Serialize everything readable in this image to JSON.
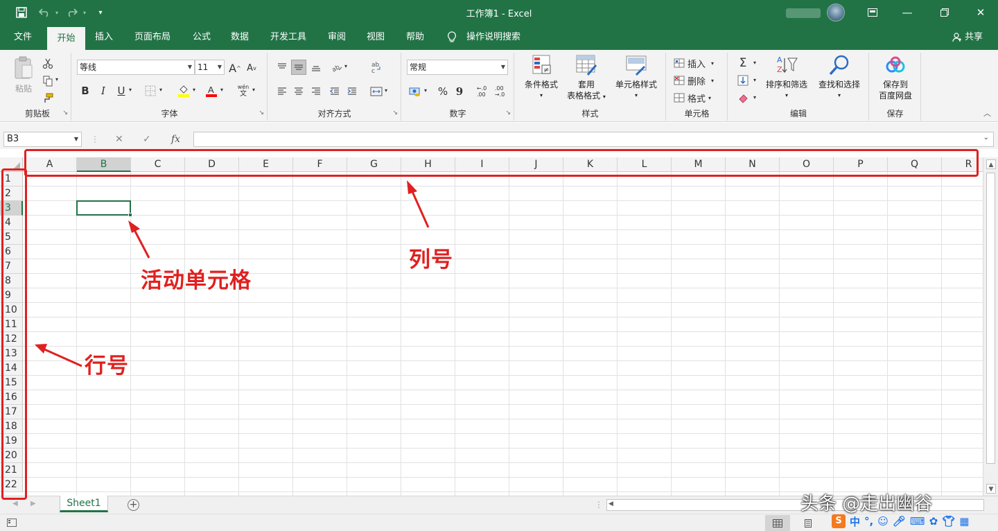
{
  "titlebar": {
    "title": "工作簿1  -  Excel",
    "save_icon": "save-icon",
    "undo_icon": "undo-icon",
    "redo_icon": "redo-icon"
  },
  "tabs": [
    "文件",
    "开始",
    "插入",
    "页面布局",
    "公式",
    "数据",
    "开发工具",
    "审阅",
    "视图",
    "帮助"
  ],
  "tell_me": "操作说明搜索",
  "share": "共享",
  "ribbon": {
    "clipboard": {
      "paste": "粘贴",
      "label": "剪贴板"
    },
    "font": {
      "name": "等线",
      "size": "11",
      "grow": "A",
      "shrink": "A",
      "bold": "B",
      "italic": "I",
      "underline": "U",
      "wen": "wén",
      "label": "字体"
    },
    "alignment": {
      "label": "对齐方式"
    },
    "number": {
      "format": "常规",
      "percent": "%",
      "comma": "9",
      "inc_dec": "←.0\n.00",
      "dec_dec": ".00\n→.0",
      "label": "数字"
    },
    "styles": {
      "conditional": "条件格式",
      "table_1": "套用",
      "table_2": "表格格式",
      "cell_styles": "单元格样式",
      "label": "样式"
    },
    "cells": {
      "insert": "插入",
      "delete": "删除",
      "format": "格式",
      "label": "单元格"
    },
    "editing": {
      "sort": "排序和筛选",
      "find": "查找和选择",
      "label": "编辑",
      "sigma": "Σ"
    },
    "save": {
      "line1": "保存到",
      "line2": "百度网盘",
      "label": "保存"
    }
  },
  "formula_bar": {
    "name_box": "B3",
    "fx": "fx"
  },
  "grid": {
    "columns": [
      "A",
      "B",
      "C",
      "D",
      "E",
      "F",
      "G",
      "H",
      "I",
      "J",
      "K",
      "L",
      "M",
      "N",
      "O",
      "P",
      "Q",
      "R"
    ],
    "rows": [
      "1",
      "2",
      "3",
      "4",
      "5",
      "6",
      "7",
      "8",
      "9",
      "10",
      "11",
      "12",
      "13",
      "14",
      "15",
      "16",
      "17",
      "18",
      "19",
      "20",
      "21",
      "22"
    ],
    "selected_column": "B",
    "selected_row": "3"
  },
  "sheets": [
    "Sheet1"
  ],
  "annotations": {
    "active_cell": "活动单元格",
    "column_numbers": "列号",
    "row_numbers": "行号"
  },
  "watermark": "头条 @走出幽谷",
  "ime": {
    "lang": "中",
    "punct": "°,"
  },
  "colors": {
    "excel_green": "#217346",
    "annotation_red": "#e02020"
  }
}
